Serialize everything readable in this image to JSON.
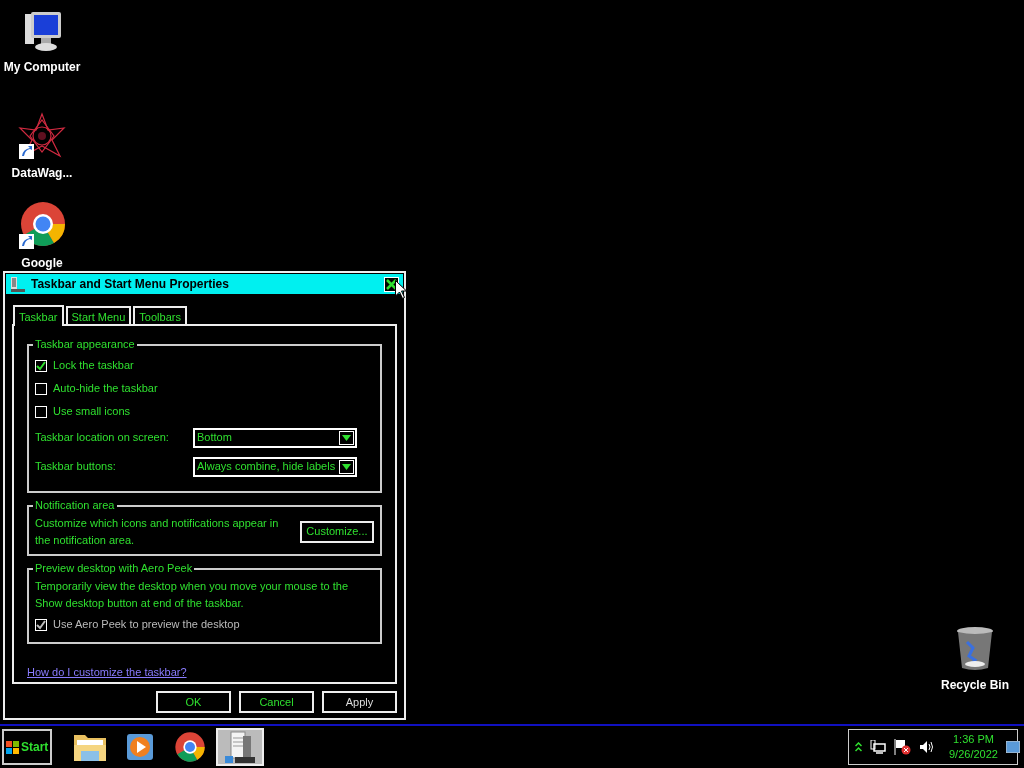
{
  "desktop_icons": [
    {
      "kind": "computer",
      "label": "My Computer"
    },
    {
      "kind": "app",
      "label": "DataWag..."
    },
    {
      "kind": "chrome",
      "label": "Google"
    },
    {
      "kind": "recycle",
      "label": "Recycle Bin"
    }
  ],
  "dialog": {
    "title": "Taskbar and Start Menu Properties",
    "tabs": [
      {
        "label": "Taskbar",
        "selected": true
      },
      {
        "label": "Start Menu",
        "selected": false
      },
      {
        "label": "Toolbars",
        "selected": false
      }
    ],
    "appearance": {
      "title": "Taskbar appearance",
      "checkboxes": [
        {
          "label": "Lock the taskbar",
          "checked": true
        },
        {
          "label": "Auto-hide the taskbar",
          "checked": false
        },
        {
          "label": "Use small icons",
          "checked": false
        }
      ],
      "dropdowns": [
        {
          "label": "Taskbar location on screen:",
          "value": "Bottom"
        },
        {
          "label": "Taskbar buttons:",
          "value": "Always combine, hide labels"
        }
      ]
    },
    "notification": {
      "title": "Notification area",
      "text": "Customize which icons and notifications appear in the notification area.",
      "button": "Customize..."
    },
    "aero_peek": {
      "title": "Preview desktop with Aero Peek",
      "text": "Temporarily view the desktop when you move your mouse to the Show desktop button at end of the taskbar.",
      "checkbox": {
        "label": "Use Aero Peek to preview the desktop",
        "checked": true,
        "disabled": true
      }
    },
    "help_link": "How do I customize the taskbar?",
    "buttons": [
      {
        "label": "OK",
        "disabled": false
      },
      {
        "label": "Cancel",
        "disabled": false
      },
      {
        "label": "Apply",
        "disabled": true
      }
    ]
  },
  "taskbar": {
    "start": "Start",
    "apps": [
      {
        "kind": "folder",
        "selected": false
      },
      {
        "kind": "media",
        "selected": false
      },
      {
        "kind": "chrome",
        "selected": false
      },
      {
        "kind": "server",
        "selected": true
      }
    ],
    "tray": {
      "time": "1:36 PM",
      "date": "9/26/2022"
    }
  }
}
